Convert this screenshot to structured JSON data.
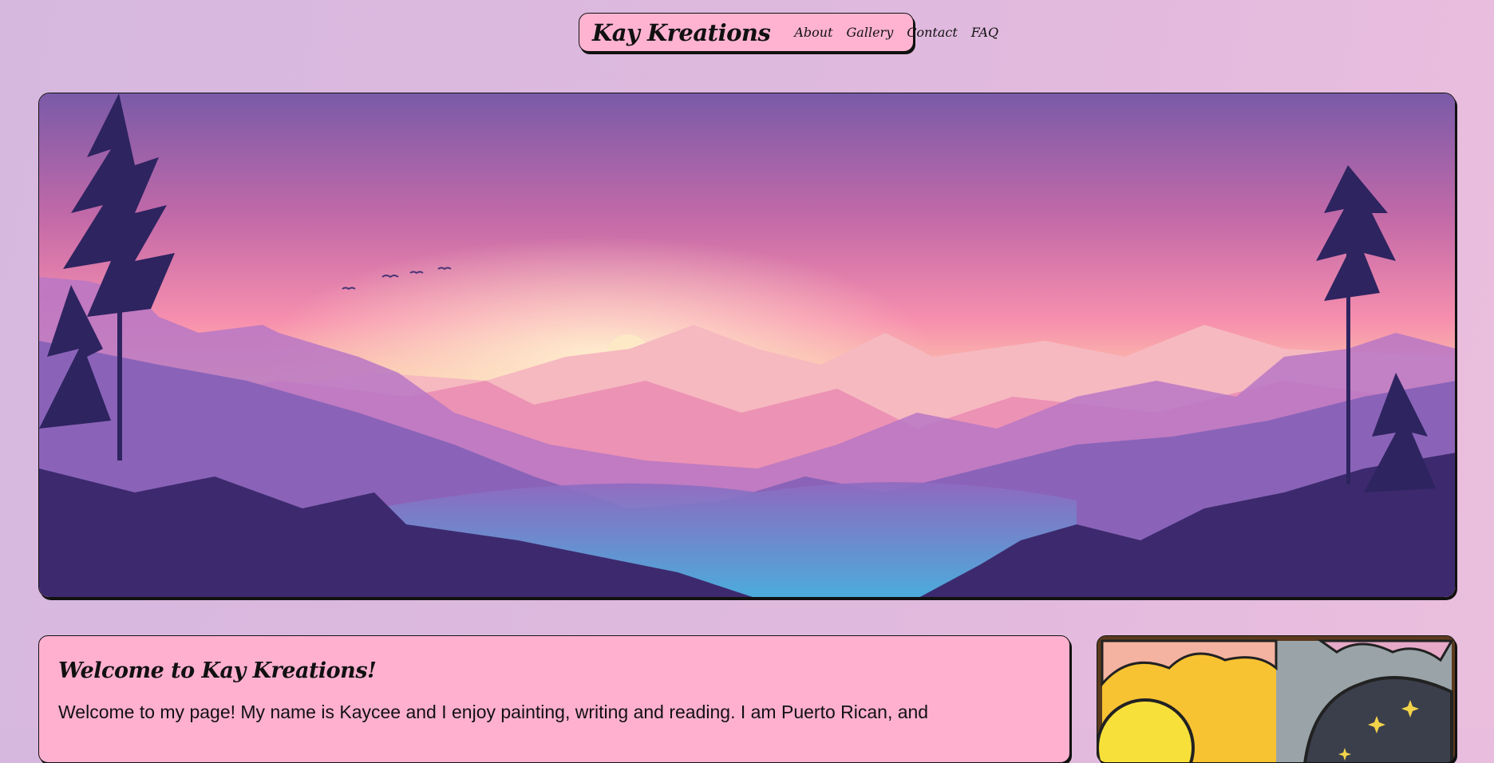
{
  "nav": {
    "brand": "Kay Kreations",
    "links": [
      "About",
      "Gallery",
      "Contact",
      "FAQ"
    ]
  },
  "hero": {
    "image_description": "mountain-sunset-landscape-illustration"
  },
  "welcome": {
    "heading": "Welcome to Kay Kreations!",
    "body": "Welcome to my page! My name is Kaycee and I enjoy painting, writing and reading. I am Puerto Rican, and"
  },
  "colors": {
    "page_bg": "#dab9df",
    "card_pink": "#ffb3d1",
    "border": "#111111"
  }
}
